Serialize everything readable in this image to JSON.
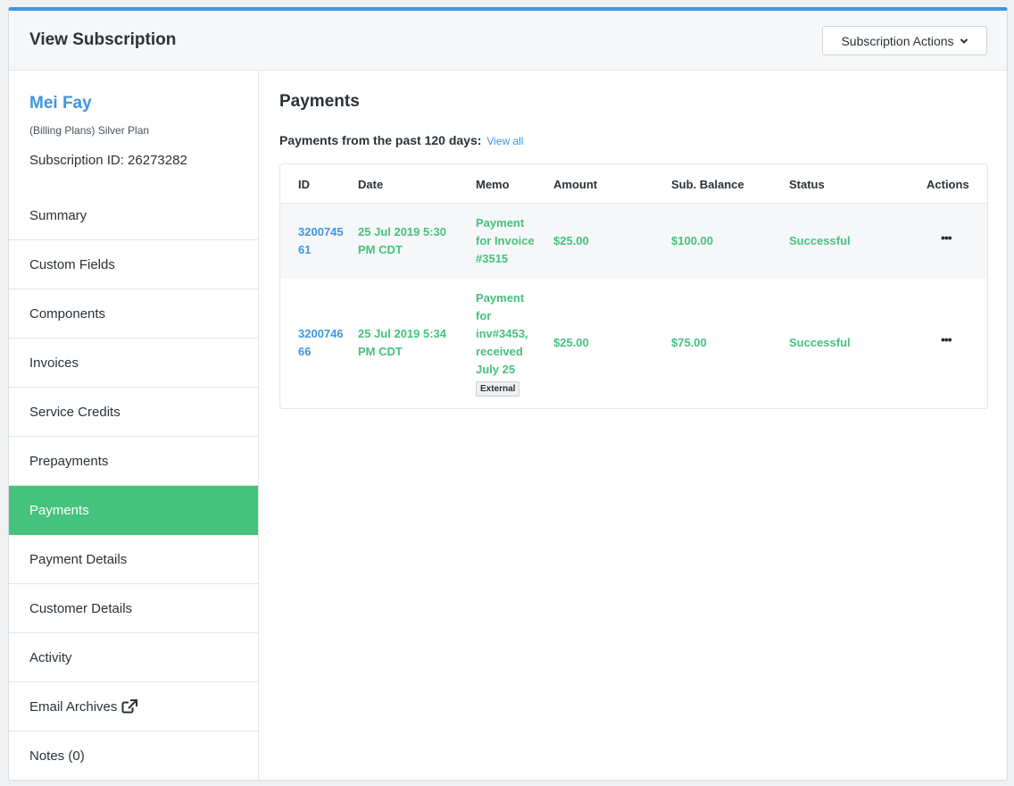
{
  "header": {
    "title": "View Subscription",
    "actions_label": "Subscription Actions"
  },
  "sidebar": {
    "customer_name": "Mei Fay",
    "plan": "(Billing Plans) Silver Plan",
    "subscription_id": "Subscription ID: 26273282",
    "items": [
      {
        "label": "Summary"
      },
      {
        "label": "Custom Fields"
      },
      {
        "label": "Components"
      },
      {
        "label": "Invoices"
      },
      {
        "label": "Service Credits"
      },
      {
        "label": "Prepayments"
      },
      {
        "label": "Payments",
        "active": true
      },
      {
        "label": "Payment Details"
      },
      {
        "label": "Customer Details"
      },
      {
        "label": "Activity"
      },
      {
        "label": "Email Archives",
        "icon": "external-link-icon"
      },
      {
        "label": "Notes (0)"
      }
    ]
  },
  "main": {
    "title": "Payments",
    "subtitle": "Payments from the past 120 days:",
    "view_all": "View all",
    "columns": [
      "ID",
      "Date",
      "Memo",
      "Amount",
      "Sub. Balance",
      "Status",
      "Actions"
    ],
    "rows": [
      {
        "id_l1": "3200745",
        "id_l2": "61",
        "date_l1": "25 Jul 2019 5:30",
        "date_l2": "PM CDT",
        "memo_l1": "Payment",
        "memo_l2": "for Invoice",
        "memo_l3": "#3515",
        "amount": "$25.00",
        "balance": "$100.00",
        "status": "Successful",
        "actions_icon": "more-horizontal-icon"
      },
      {
        "id_l1": "3200746",
        "id_l2": "66",
        "date_l1": "25 Jul 2019 5:34",
        "date_l2": "PM CDT",
        "memo_l1": "Payment",
        "memo_l2": "for",
        "memo_l3": "inv#3453,",
        "memo_l4": "received",
        "memo_l5": "July 25",
        "badge": "External",
        "amount": "$25.00",
        "balance": "$75.00",
        "status": "Successful",
        "actions_icon": "more-horizontal-icon"
      }
    ]
  },
  "colors": {
    "accent_blue": "#3f96e0",
    "success_green": "#45c27d",
    "text_dark": "#2b3238"
  }
}
